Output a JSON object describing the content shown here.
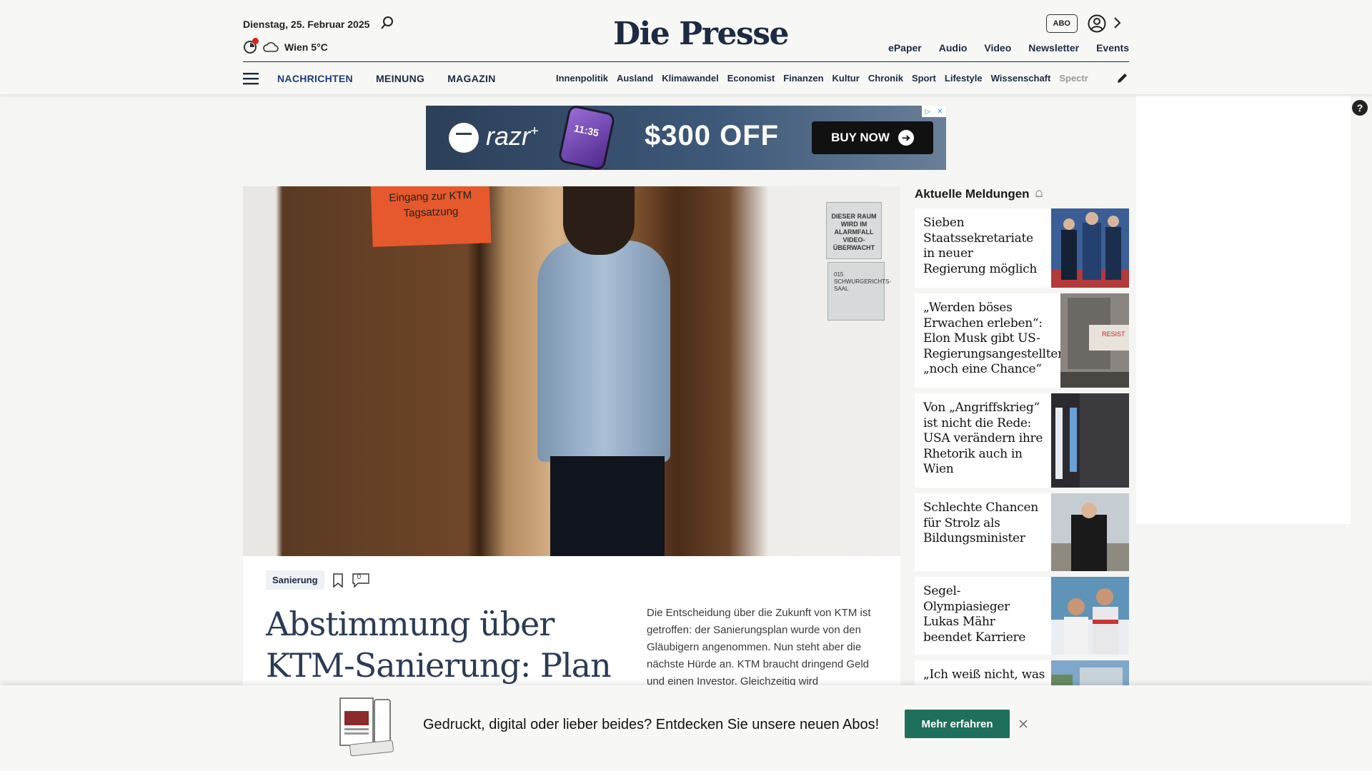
{
  "header": {
    "date": "Dienstag, 25. Februar 2025",
    "weather": "Wien 5°C",
    "logo": "Die Presse",
    "abo_label": "ABO",
    "top_links": [
      "ePaper",
      "Audio",
      "Video",
      "Newsletter",
      "Events"
    ],
    "main_nav": [
      "NACHRICHTEN",
      "MEINUNG",
      "MAGAZIN"
    ],
    "sub_nav": [
      "Innenpolitik",
      "Ausland",
      "Klimawandel",
      "Economist",
      "Finanzen",
      "Kultur",
      "Chronik",
      "Sport",
      "Lifestyle",
      "Wissenschaft",
      "Spectr"
    ]
  },
  "ad": {
    "brand": "razr",
    "brand_sup": "+",
    "phone_time": "11:35",
    "offer": "$300 OFF",
    "button": "BUY NOW"
  },
  "article": {
    "image_sign": "Eingang zur KTM Tagsatzung",
    "image_plaque": "DIESER RAUM WIRD IM ALARMFALL VIDEO-ÜBERWACHT",
    "image_plaque2": "015 SCHWURGERICHTS-SAAL",
    "tag": "Sanierung",
    "comment_count": "0",
    "headline": "Abstimmung über KTM-Sanierung: Plan",
    "teaser": "Die Entscheidung über die Zukunft von KTM ist getroffen: der Sanierungsplan wurde von den Gläubigern angenommen. Nun steht aber die nächste Hürde an. KTM braucht dringend Geld und einen Investor. Gleichzeitig wird"
  },
  "news": {
    "heading": "Aktuelle Meldungen",
    "items": [
      {
        "title": "Sieben Staatssekretariate in neuer Regierung möglich"
      },
      {
        "title": "„Werden böses Erwachen erleben“: Elon Musk gibt US-Regierungsangestellten „noch eine Chance“"
      },
      {
        "title": "Von „Angriffskrieg“ ist nicht die Rede: USA verändern ihre Rhetorik auch in Wien"
      },
      {
        "title": "Schlechte Chancen für Strolz als Bildungsminister"
      },
      {
        "title": "Segel-Olympiasieger Lukas Mähr beendet Karriere"
      },
      {
        "title": "„Ich weiß nicht, was"
      }
    ]
  },
  "bottom": {
    "text": "Gedruckt, digital oder lieber beides? Entdecken Sie unsere neuen Abos!",
    "cta": "Mehr erfahren"
  },
  "colors": {
    "navy": "#1c2a44",
    "cta_green": "#1e6f5c",
    "accent_red": "#e0211b"
  }
}
